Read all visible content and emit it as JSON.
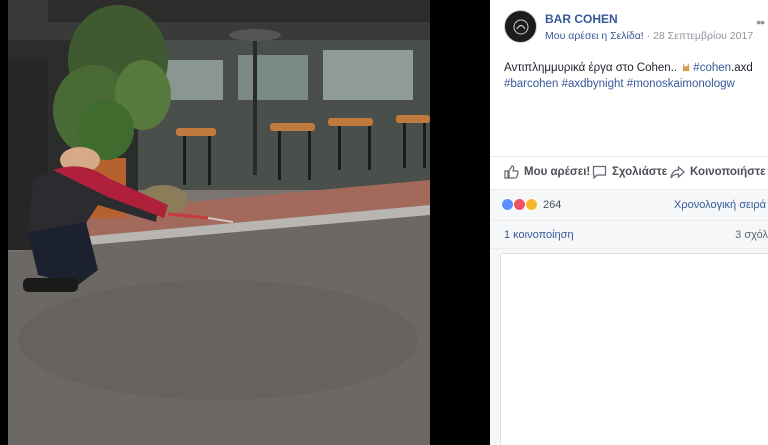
{
  "photo": {
    "alt_semantic": "man-watering-street-photo"
  },
  "page": {
    "name": "BAR COHEN",
    "like_page": "Μου αρέσει η Σελίδα!",
    "separator": " · ",
    "date": "28 Σεπτεμβρίου 2017",
    "more": "••"
  },
  "post": {
    "text_main": "Αντιπλημμυρικά έργα στο Cohen..",
    "tag_cohen": "#cohen",
    "text_axd": ".axd",
    "tag_barcohen": "#barcohen",
    "tag_axdbynight": "#axdbynight",
    "tag_monos": "#monoskaimonologw"
  },
  "actions": {
    "like": "Μου αρέσει!",
    "comment": "Σχολιάστε",
    "share": "Κοινοποιήστε"
  },
  "reactions": {
    "count": "264",
    "order_label": "Χρονολογική σειρά",
    "colors": {
      "like": "#5890ff",
      "love": "#f25268",
      "haha": "#f7b928"
    }
  },
  "stats": {
    "shares": "1 κοινοποίηση",
    "comments": "3 σχόλ"
  },
  "colors": {
    "link": "#365899",
    "muted": "#90949c",
    "divider": "#e9ebee"
  }
}
